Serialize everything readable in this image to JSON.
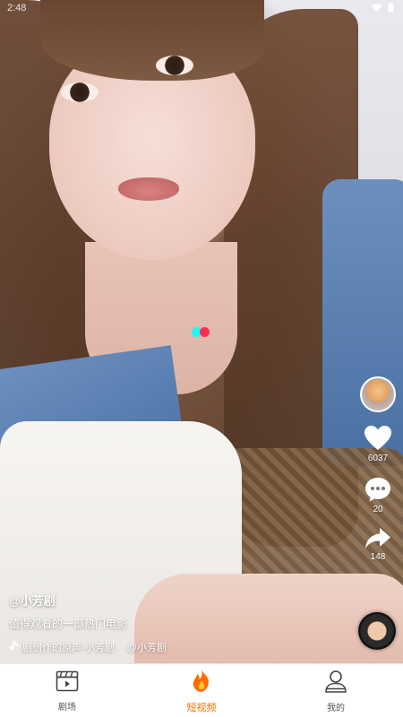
{
  "status_bar": {
    "time": "2:48"
  },
  "actions": {
    "likes": "6037",
    "comments": "20",
    "shares": "148"
  },
  "post": {
    "author": "@小芳剧",
    "description": "值得观看的一部热门电影",
    "music_title": "剧创作的原声-小芳剧",
    "music_author": "@小芳剧"
  },
  "bottom_nav": {
    "items": [
      {
        "label": "剧场",
        "icon": "clapperboard-icon"
      },
      {
        "label": "短视频",
        "icon": "flame-icon",
        "active": true
      },
      {
        "label": "我的",
        "icon": "user-icon"
      }
    ]
  },
  "colors": {
    "accent": "#ff6a00",
    "dot_cyan": "#25f4ee",
    "dot_red": "#fe2c55"
  }
}
